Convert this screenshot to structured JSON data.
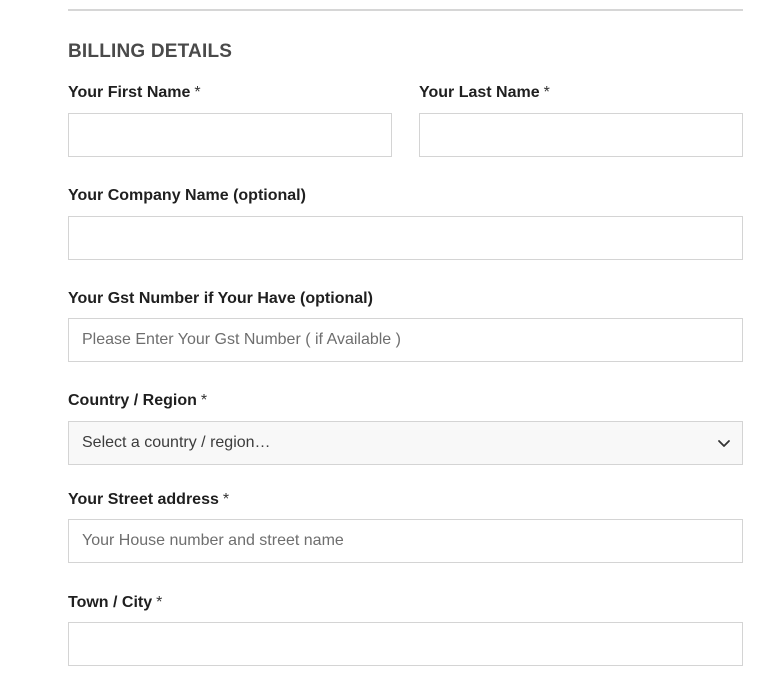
{
  "form": {
    "section_title": "BILLING DETAILS",
    "required_marker": "*",
    "first_name": {
      "label": "Your First Name",
      "value": "",
      "placeholder": ""
    },
    "last_name": {
      "label": "Your Last Name",
      "value": "",
      "placeholder": ""
    },
    "company": {
      "label": "Your Company Name (optional)",
      "value": "",
      "placeholder": ""
    },
    "gst": {
      "label": "Your Gst Number if Your Have (optional)",
      "value": "",
      "placeholder": "Please Enter Your Gst Number ( if Available )"
    },
    "country": {
      "label": "Country / Region",
      "selected": "Select a country / region…",
      "icon": "chevron-down-icon"
    },
    "street": {
      "label": "Your Street address",
      "value": "",
      "placeholder": "Your House number and street name"
    },
    "city": {
      "label": "Town / City",
      "value": "",
      "placeholder": ""
    }
  }
}
